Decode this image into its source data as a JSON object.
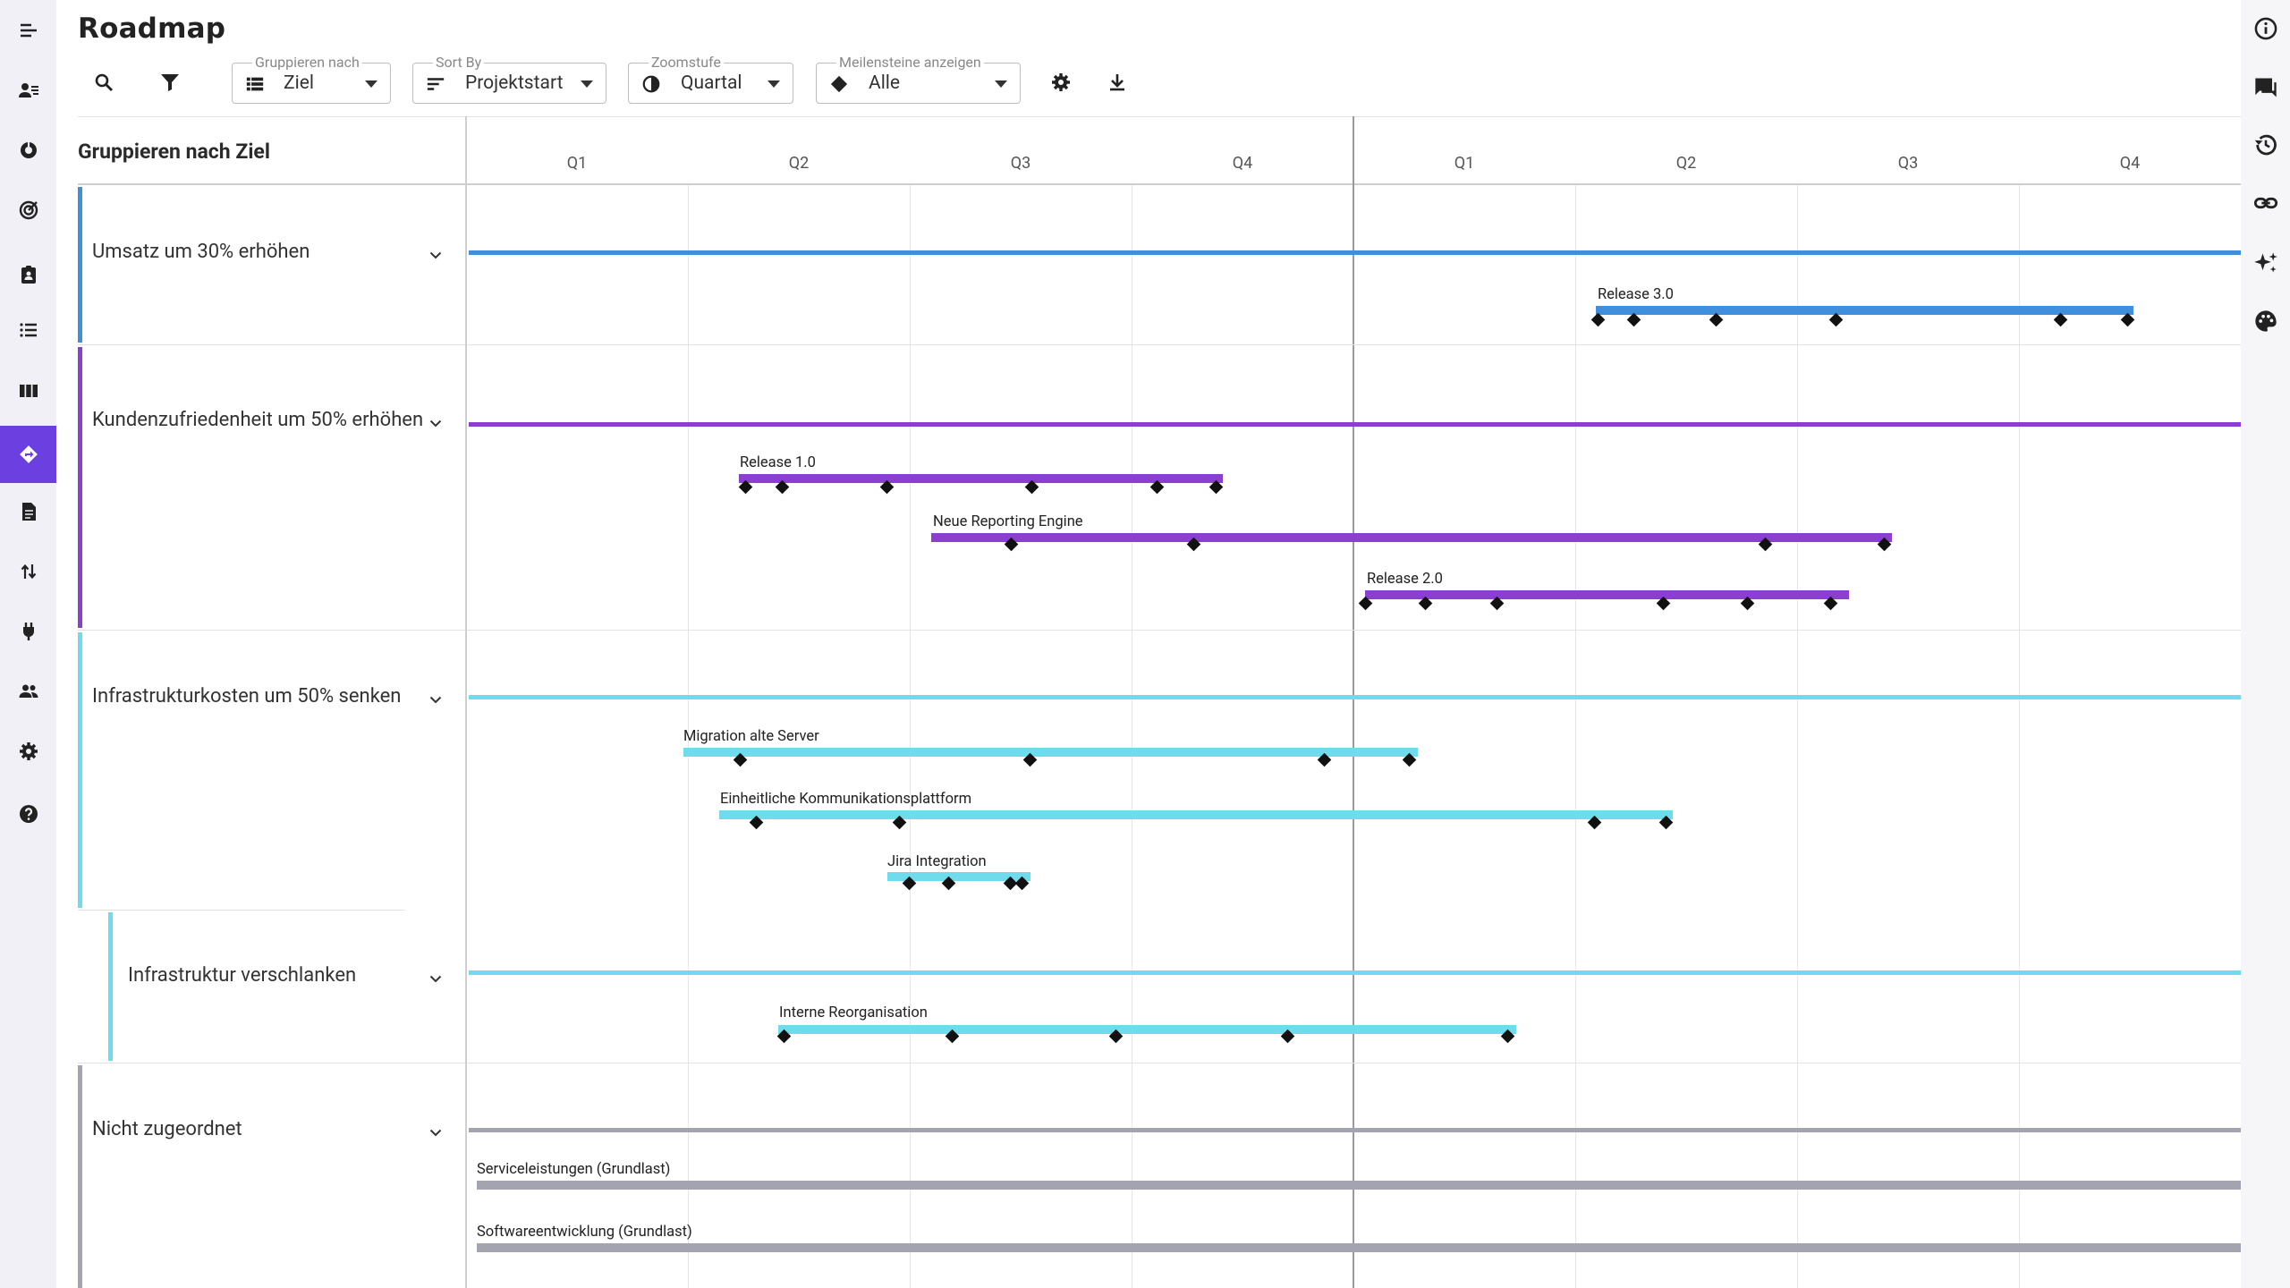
{
  "page_title": "Roadmap",
  "toolbar": {
    "group_by": {
      "label": "Gruppieren nach",
      "value": "Ziel"
    },
    "sort_by": {
      "label": "Sort By",
      "value": "Projektstart"
    },
    "zoom": {
      "label": "Zoomstufe",
      "value": "Quartal"
    },
    "milestones": {
      "label": "Meilensteine anzeigen",
      "value": "Alle"
    }
  },
  "group_header": "Gruppieren nach Ziel",
  "timeline": {
    "quarters": [
      "Q1",
      "Q2",
      "Q3",
      "Q4",
      "Q1",
      "Q2",
      "Q3",
      "Q4"
    ]
  },
  "groups": [
    {
      "name": "Umsatz um 30% erhöhen",
      "color": "#3f8fdc"
    },
    {
      "name": "Kundenzufriedenheit um 50% erhöhen",
      "color": "#8a3fd1"
    },
    {
      "name": "Infrastrukturkosten um 50% senken",
      "color": "#6fdcee"
    },
    {
      "name": "Infrastruktur verschlanken",
      "color": "#6fdcee"
    },
    {
      "name": "Nicht zugeordnet",
      "color": "#a4a3b0"
    }
  ],
  "projects": [
    {
      "name": "Release 3.0",
      "group": "Umsatz um 30% erhöhen"
    },
    {
      "name": "Release 1.0",
      "group": "Kundenzufriedenheit um 50% erhöhen"
    },
    {
      "name": "Neue Reporting Engine",
      "group": "Kundenzufriedenheit um 50% erhöhen"
    },
    {
      "name": "Release 2.0",
      "group": "Kundenzufriedenheit um 50% erhöhen"
    },
    {
      "name": "Migration alte Server",
      "group": "Infrastrukturkosten um 50% senken"
    },
    {
      "name": "Einheitliche Kommunikationsplattform",
      "group": "Infrastrukturkosten um 50% senken"
    },
    {
      "name": "Jira Integration",
      "group": "Infrastrukturkosten um 50% senken"
    },
    {
      "name": "Interne Reorganisation",
      "group": "Infrastruktur verschlanken"
    },
    {
      "name": "Serviceleistungen (Grundlast)",
      "group": "Nicht zugeordnet"
    },
    {
      "name": "Softwareentwicklung (Grundlast)",
      "group": "Nicht zugeordnet"
    }
  ]
}
